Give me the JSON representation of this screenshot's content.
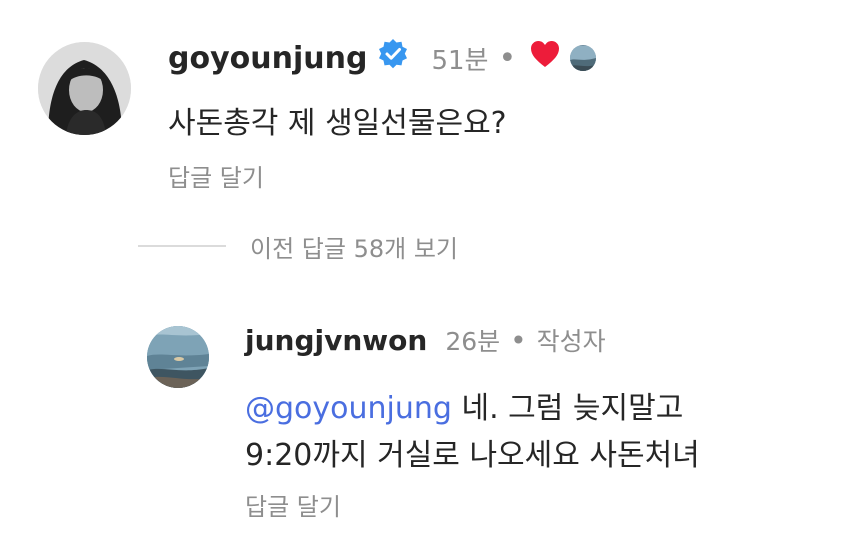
{
  "main_comment": {
    "username": "goyounjung",
    "time": "51분",
    "separator": "•",
    "text": "사돈총각 제 생일선물은요?",
    "reply_label": "답글 달기",
    "liked_by_author": true
  },
  "view_previous": {
    "label": "이전 답글 58개 보기"
  },
  "reply_comment": {
    "username": "jungjvnwon",
    "time": "26분",
    "separator": "•",
    "author_tag": "작성자",
    "mention": "@goyounjung",
    "text_line1_rest": " 네. 그럼 늦지말고",
    "text_line2": "9:20까지 거실로 나오세요 사돈처녀",
    "reply_label": "답글 달기"
  },
  "colors": {
    "text": "#262626",
    "secondary": "#8e8e8e",
    "mention": "#4a6ee0",
    "heart": "#ed1c3a",
    "verified": "#3897f0"
  }
}
